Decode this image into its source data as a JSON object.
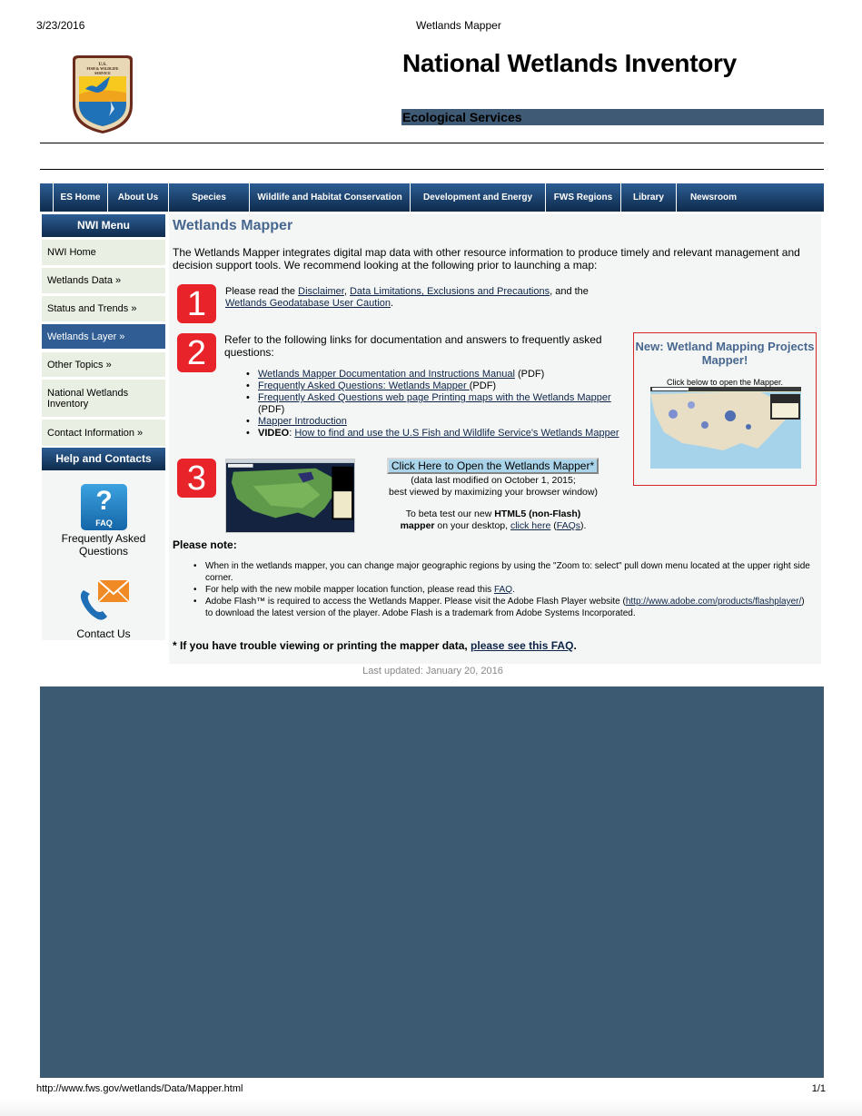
{
  "print_header": {
    "date": "3/23/2016",
    "title": "Wetlands Mapper"
  },
  "header": {
    "logo_text": "U.S. Fish & Wildlife Service",
    "site_title": "National Wetlands Inventory",
    "subtitle": "Ecological Services"
  },
  "topnav": {
    "items": [
      {
        "label": "ES Home"
      },
      {
        "label": "About Us"
      },
      {
        "label": "Species"
      },
      {
        "label": "Wildlife and Habitat Conservation"
      },
      {
        "label": "Development and Energy"
      },
      {
        "label": "FWS Regions"
      },
      {
        "label": "Library"
      },
      {
        "label": "Newsroom"
      }
    ]
  },
  "sidebar": {
    "menu_title": "NWI Menu",
    "items": [
      {
        "label": "NWI Home",
        "active": false
      },
      {
        "label": "Wetlands Data »",
        "active": false
      },
      {
        "label": "Status and Trends »",
        "active": false
      },
      {
        "label": "Wetlands Layer »",
        "active": true
      },
      {
        "label": "Other Topics »",
        "active": false
      },
      {
        "label": "National Wetlands Inventory",
        "active": false
      },
      {
        "label": "Contact Information »",
        "active": false
      }
    ],
    "help_title": "Help and Contacts",
    "faq_icon_q": "?",
    "faq_icon_label": "FAQ",
    "faq_label": "Frequently Asked Questions",
    "contact_label": "Contact Us"
  },
  "main": {
    "title": "Wetlands Mapper",
    "intro": "The Wetlands Mapper integrates digital map data with other resource information to produce timely and relevant management and decision support tools. We recommend looking at the following prior to launching a map:",
    "step1": {
      "number": "1",
      "prefix": "Please read the ",
      "link1": "Disclaimer",
      "sep1": ", ",
      "link2": "Data Limitations, Exclusions and Precautions",
      "sep2": ", and the ",
      "link3": "Wetlands Geodatabase User Caution",
      "suffix": "."
    },
    "step2": {
      "number": "2",
      "text": "Refer to the following links for documentation and answers to frequently asked questions:",
      "links": [
        {
          "link": "Wetlands Mapper Documentation and Instructions Manual",
          "suffix": " (PDF)",
          "prefix": ""
        },
        {
          "link": "Frequently Asked Questions: Wetlands Mapper ",
          "suffix": "(PDF)",
          "prefix": ""
        },
        {
          "link": "Frequently Asked Questions web page Printing maps with the Wetlands Mapper",
          "suffix": " (PDF)",
          "prefix": ""
        },
        {
          "link": "Mapper Introduction",
          "suffix": "",
          "prefix": ""
        },
        {
          "link": "How to find and use the U.S Fish and Wildlife Service's Wetlands Mapper",
          "suffix": "",
          "prefix": "VIDEO"
        }
      ]
    },
    "step3": {
      "number": "3",
      "open_button": "Click Here to Open the Wetlands Mapper*",
      "open_note_line1": "(data last modified on October 1, 2015;",
      "open_note_line2": "best viewed by maximizing your browser window)",
      "beta_prefix": "To beta test our new ",
      "beta_bold1": "HTML5 (non-Flash)",
      "beta_bold2": "mapper",
      "beta_mid": " on your desktop, ",
      "beta_link": "click here",
      "beta_paren_open": " (",
      "beta_faq_link": "FAQs",
      "beta_end": ")."
    },
    "promo": {
      "title": "New: Wetland Mapping Projects Mapper!",
      "subtitle": "Click below to open the Mapper."
    },
    "please_note": "Please note:",
    "notes": [
      {
        "text": "When in the wetlands mapper, you can change major geographic regions by using the \"Zoom to: select\" pull down menu located at the upper right side corner."
      },
      {
        "prefix": "For help with the new mobile mapper location function, please read this ",
        "link": "FAQ",
        "suffix": "."
      },
      {
        "prefix": "Adobe Flash™ is required to access the Wetlands Mapper. Please visit the Adobe Flash Player website (",
        "link": "http://www.adobe.com/products/flashplayer/",
        "suffix": ") to download the latest version of the player. Adobe Flash is a trademark from Adobe Systems Incorporated."
      }
    ],
    "trouble_prefix": "* If you have trouble viewing or printing the mapper data, ",
    "trouble_link": "please see this FAQ",
    "trouble_suffix": "."
  },
  "last_updated": "Last updated: January 20, 2016",
  "colors": {
    "nav_top": "#2c5d93",
    "nav_bottom": "#0e2b4c",
    "accent_band": "#3c5a72",
    "badge_red": "#e8232a",
    "heading_blue": "#48678f",
    "sidebar_bg": "#e9efe2"
  },
  "print_footer": {
    "url": "http://www.fws.gov/wetlands/Data/Mapper.html",
    "page": "1/1"
  }
}
